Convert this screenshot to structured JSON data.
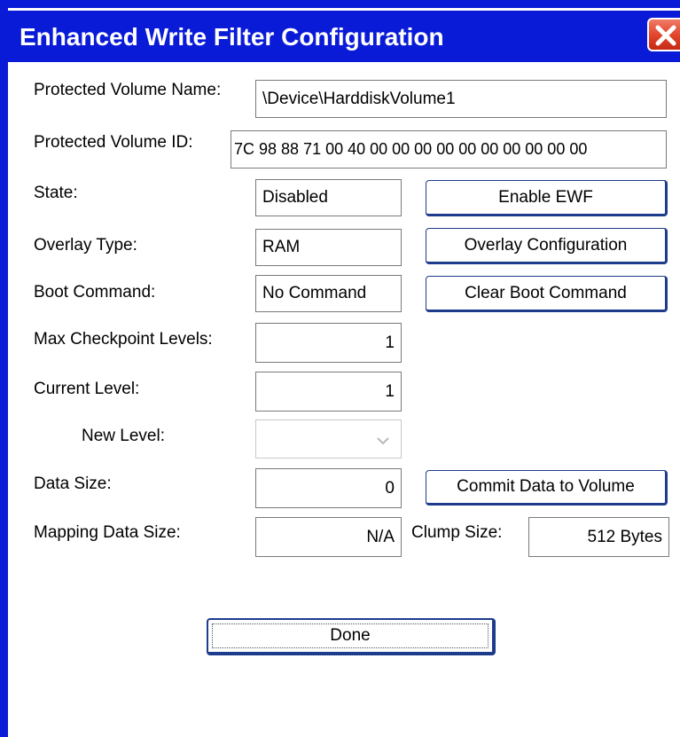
{
  "window": {
    "title": "Enhanced Write Filter Configuration",
    "close_icon": "close-icon",
    "accent_color": "#0a1bd8",
    "close_color": "#e0432a"
  },
  "fields": {
    "protected_volume_name": {
      "label": "Protected Volume Name:",
      "value": "\\Device\\HarddiskVolume1"
    },
    "protected_volume_id": {
      "label": "Protected Volume ID:",
      "value": "7C 98 88 71 00 40 00 00 00 00 00 00 00 00 00 00"
    },
    "state": {
      "label": "State:",
      "value": "Disabled"
    },
    "overlay_type": {
      "label": "Overlay Type:",
      "value": "RAM"
    },
    "boot_command": {
      "label": "Boot Command:",
      "value": "No Command"
    },
    "max_checkpoint_levels": {
      "label": "Max Checkpoint Levels:",
      "value": "1"
    },
    "current_level": {
      "label": "Current Level:",
      "value": "1"
    },
    "new_level": {
      "label": "New Level:",
      "value": "",
      "icon": "chevron-down-icon"
    },
    "data_size": {
      "label": "Data Size:",
      "value": "0"
    },
    "mapping_data_size": {
      "label": "Mapping Data Size:",
      "value": "N/A"
    },
    "clump_size": {
      "label": "Clump Size:",
      "value": "512 Bytes"
    }
  },
  "buttons": {
    "enable_ewf": "Enable EWF",
    "overlay_configuration": "Overlay Configuration",
    "clear_boot_command": "Clear Boot Command",
    "commit_data": "Commit Data to Volume",
    "done": "Done"
  }
}
